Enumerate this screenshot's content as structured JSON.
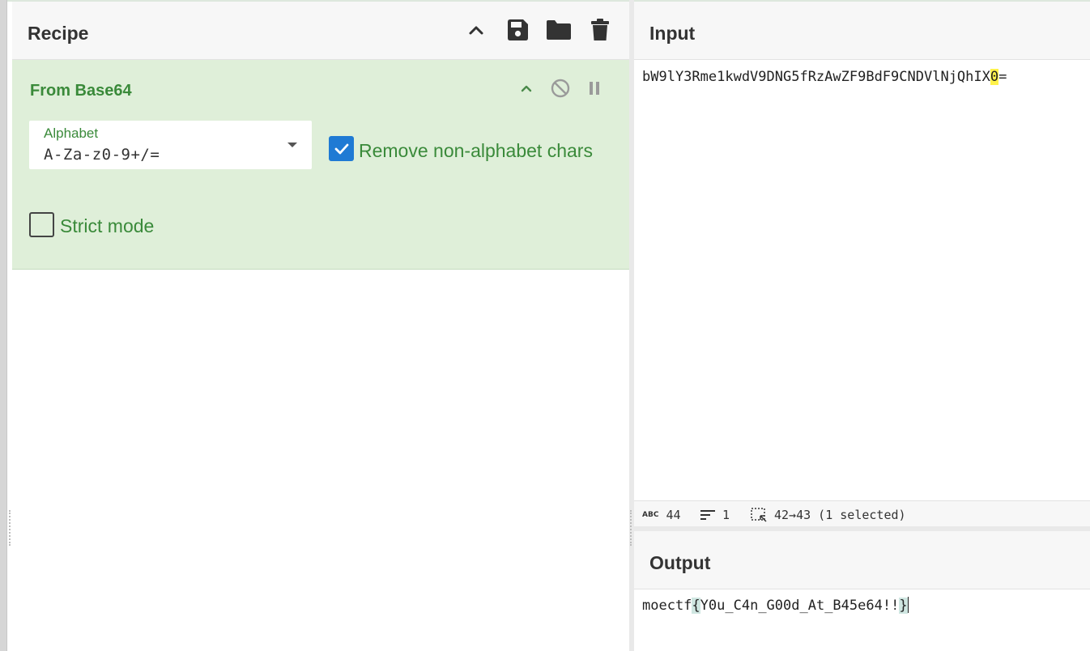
{
  "recipe": {
    "title": "Recipe",
    "operation": {
      "title": "From Base64",
      "alphabet_label": "Alphabet",
      "alphabet_value": "A-Za-z0-9+/=",
      "remove_non_alphabet_label": "Remove non-alphabet chars",
      "remove_non_alphabet_checked": true,
      "strict_mode_label": "Strict mode",
      "strict_mode_checked": false
    }
  },
  "input": {
    "title": "Input",
    "text_before": "bW9lY3Rme1kwdV9DNG5fRzAwZF9BdF9CNDVlNjQhIX",
    "text_highlight": "0",
    "text_after": "=",
    "status": {
      "length": "44",
      "lines": "1",
      "selection": "42→43 (1 selected)"
    }
  },
  "output": {
    "title": "Output",
    "text_prefix": "moectf",
    "brace_open": "{",
    "text_middle": "Y0u_C4n_G00d_At_B45e64!!",
    "brace_close": "}"
  },
  "colors": {
    "accent_green": "#3a8a3a",
    "operation_bg": "#dfefd9",
    "checkbox_blue": "#1f7ad4",
    "highlight_yellow": "#fff24a",
    "highlight_teal": "#cfe6e1"
  }
}
